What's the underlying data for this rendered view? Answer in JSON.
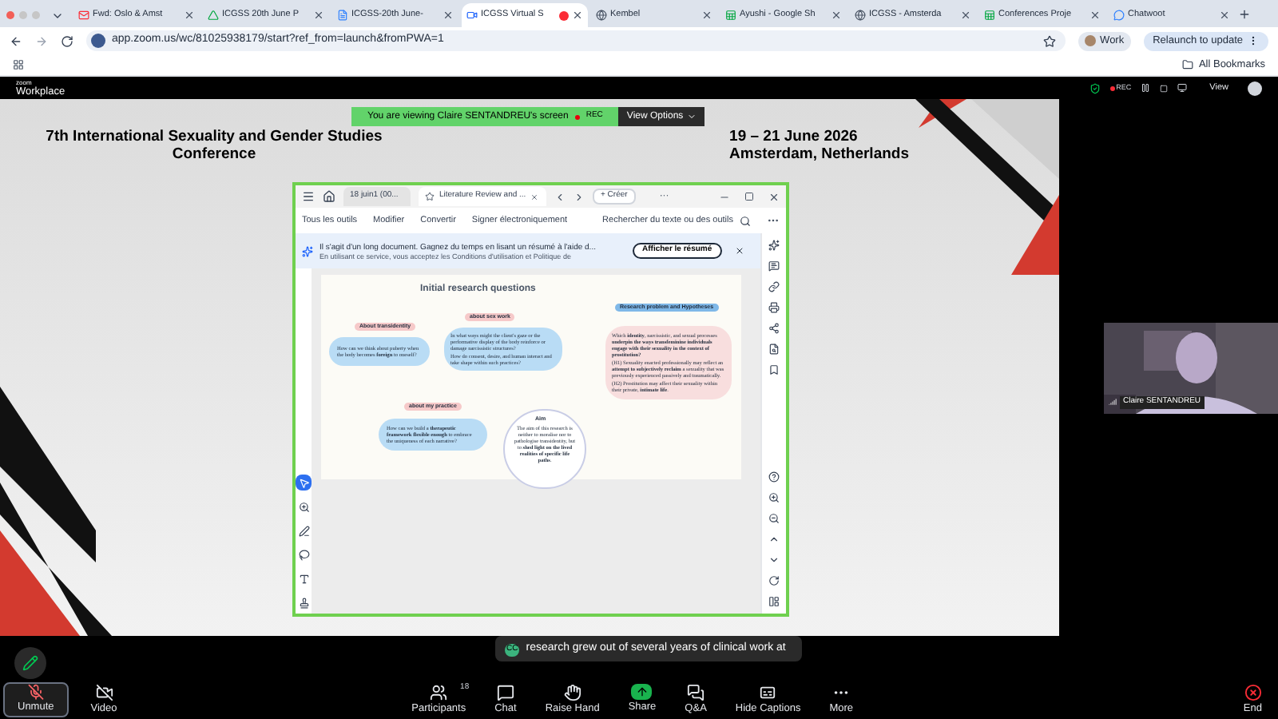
{
  "browser": {
    "tabs": [
      {
        "kind": "mail",
        "title": "Fwd: Oslo & Amst",
        "selected": false
      },
      {
        "kind": "drive",
        "title": "ICGSS 20th June P",
        "selected": false
      },
      {
        "kind": "doc",
        "title": "ICGSS-20th June-",
        "selected": false
      },
      {
        "kind": "video",
        "title": "ICGSS Virtual S",
        "selected": true
      },
      {
        "kind": "globe",
        "title": "Kembel",
        "selected": false
      },
      {
        "kind": "sheet",
        "title": "Ayushi - Google Sh",
        "selected": false
      },
      {
        "kind": "globe",
        "title": "ICGSS - Amsterda",
        "selected": false
      },
      {
        "kind": "sheet",
        "title": "Conferences Proje",
        "selected": false
      },
      {
        "kind": "chat",
        "title": "Chatwoot",
        "selected": false
      }
    ],
    "address": "app.zoom.us/wc/81025938179/start?ref_from=launch&fromPWA=1",
    "profile": "Work",
    "relaunch": "Relaunch to update",
    "bookmarks": "All Bookmarks"
  },
  "zoom_bar": {
    "logo_top": "zoom",
    "logo": "Workplace",
    "rec": "REC",
    "view": "View"
  },
  "share_banner": {
    "text": "You are viewing  Claire SENTANDREU's screen",
    "rec": "REC",
    "options": "View Options"
  },
  "slide": {
    "title": "7th International Sexuality and Gender Studies Conference",
    "dates": "19 – 21 June 2026",
    "place": "Amsterdam, Netherlands"
  },
  "pdf_window": {
    "tabs": [
      {
        "label": "18 juin1 (00...",
        "selected": false
      },
      {
        "label": "Literature Review and ...",
        "selected": true
      }
    ],
    "create": "+ Créer",
    "more": "···",
    "menu": [
      "Tous les outils",
      "Modifier",
      "Convertir",
      "Signer électroniquement"
    ],
    "search": "Rechercher du texte ou des outils",
    "notice": {
      "text": "Il s'agit d'un long document. Gagnez du temps en lisant un résumé à l'aide d...",
      "subtext": "En utilisant ce service, vous acceptez les Conditions d'utilisation et Politique de",
      "button": "Afficher le résumé"
    },
    "page": {
      "title": "Initial research questions",
      "nodes": [
        {
          "kind": "bubble",
          "label": "About transidentity",
          "items": [
            "How can we think about puberty when the body becomes **foreign** to oneself?"
          ]
        },
        {
          "kind": "bubble",
          "label": "about sex work",
          "items": [
            "In what ways might the client's gaze or the performative display of the body reinforce or damage narcissistic structures?",
            "How do consent, desire, and human interact and take shape within such practices?"
          ]
        },
        {
          "kind": "bubble",
          "label": "about my practice",
          "items": [
            "How can we build a **therapeutic framework flexible enough** to embrace the uniqueness of each narrative?"
          ]
        },
        {
          "kind": "circle",
          "label": "Aim",
          "items": [
            "The aim of this research is neither to moralise nor to pathologise transidentity, but to **shed light on the lived realities of specific life paths**."
          ]
        },
        {
          "kind": "panel",
          "label": "Research problem and Hypotheses",
          "items": [
            "Which **identity**, narcissistic, and sexual processes **underpin the ways transfeminine individuals engage with their sexuality in the context of prostitution?**",
            "(H1) Sexuality enacted professionally may reflect an **attempt to subjectively reclaim** a sexuality that was previously experienced passively and traumatically.",
            "(H2) Prostitution may affect their sexuality within their private, **intimate life**."
          ]
        }
      ]
    },
    "tools": [
      {
        "kind": "cursor",
        "selected": true
      },
      {
        "kind": "zoom",
        "selected": false
      },
      {
        "kind": "pen",
        "selected": false
      },
      {
        "kind": "lasso",
        "selected": false
      },
      {
        "kind": "text",
        "selected": false
      },
      {
        "kind": "stamp",
        "selected": false
      }
    ]
  },
  "participant": {
    "name": "Claire SENTANDREU"
  },
  "caption": {
    "badge": "CC",
    "text": "research grew out of several years of clinical work at"
  },
  "toolbar": [
    {
      "kind": "mic",
      "label": "Unmute",
      "selected": true
    },
    {
      "kind": "video",
      "label": "Video",
      "selected": false
    },
    {
      "kind": "participants",
      "label": "Participants",
      "count": "18",
      "selected": false
    },
    {
      "kind": "chat",
      "label": "Chat",
      "selected": false
    },
    {
      "kind": "hand",
      "label": "Raise Hand",
      "selected": false
    },
    {
      "kind": "share",
      "label": "Share",
      "selected": false
    },
    {
      "kind": "qa",
      "label": "Q&A",
      "selected": false
    },
    {
      "kind": "captions",
      "label": "Hide Captions",
      "selected": false
    },
    {
      "kind": "more",
      "label": "More",
      "selected": false
    },
    {
      "kind": "end",
      "label": "End",
      "selected": false
    }
  ]
}
